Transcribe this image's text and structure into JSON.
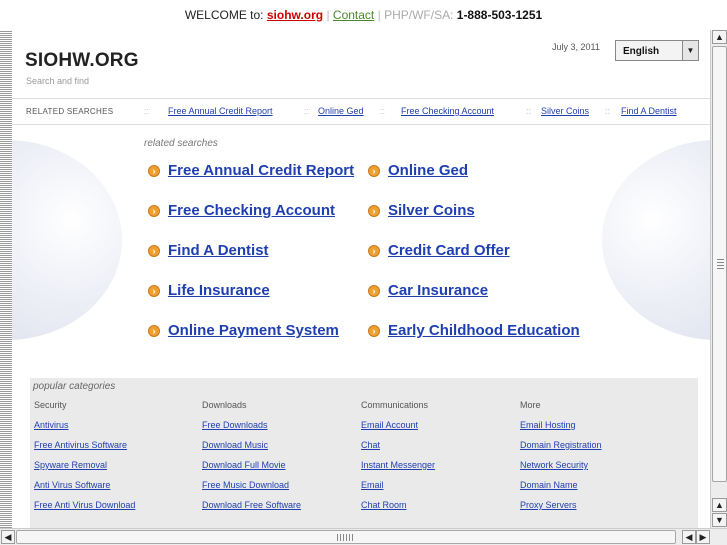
{
  "topbar": {
    "welcome": "WELCOME to:",
    "site": "siohw.org",
    "contact": "Contact",
    "info": "PHP/WF/SA:",
    "phone": "1-888-503-1251"
  },
  "header": {
    "logo": "SIOHW.ORG",
    "tagline": "Search and find",
    "date": "July 3, 2011",
    "language": "English"
  },
  "related_bar": {
    "label": "RELATED SEARCHES",
    "items": [
      "Free Annual Credit Report",
      "Online Ged",
      "Free Checking Account",
      "Silver Coins",
      "Find A Dentist"
    ]
  },
  "related": {
    "heading": "related searches",
    "items": [
      "Free Annual Credit Report",
      "Online Ged",
      "Free Checking Account",
      "Silver Coins",
      "Find A Dentist",
      "Credit Card Offer",
      "Life Insurance",
      "Car Insurance",
      "Online Payment System",
      "Early Childhood Education"
    ]
  },
  "popular": {
    "heading": "popular categories",
    "columns": [
      {
        "title": "Security",
        "links": [
          "Antivirus",
          "Free Antivirus Software",
          "Spyware Removal",
          "Anti Virus Software",
          "Free Anti Virus Download"
        ]
      },
      {
        "title": "Downloads",
        "links": [
          "Free Downloads",
          "Download Music",
          "Download Full Movie",
          "Free Music Download",
          "Download Free Software"
        ]
      },
      {
        "title": "Communications",
        "links": [
          "Email Account",
          "Chat",
          "Instant Messenger",
          "Email",
          "Chat Room"
        ]
      },
      {
        "title": "More",
        "links": [
          "Email Hosting",
          "Domain Registration",
          "Network Security",
          "Domain Name",
          "Proxy Servers"
        ]
      }
    ]
  },
  "colors": {
    "link": "#1f3fb0",
    "site_link": "#cc0000",
    "contact_link": "#4a8a2a",
    "arrow_icon": "#f0a030",
    "panel": "#eaeaea"
  }
}
